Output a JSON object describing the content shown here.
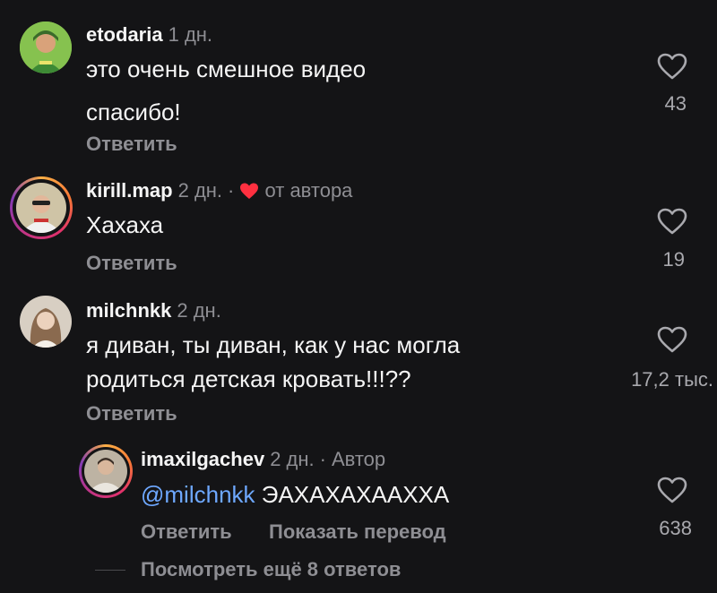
{
  "comments": [
    {
      "username": "etodaria",
      "time": "1 дн.",
      "lines": [
        "это очень смешное видео",
        "спасибо!"
      ],
      "reply_label": "Ответить",
      "likes": "43"
    },
    {
      "username": "kirill.map",
      "time": "2 дн.",
      "dot": "·",
      "author_badge": "от автора",
      "lines": [
        "Хахаха"
      ],
      "reply_label": "Ответить",
      "likes": "19"
    },
    {
      "username": "milchnkk",
      "time": "2 дн.",
      "lines": [
        "я диван, ты диван, как у нас могла",
        "родиться детская кровать!!!??"
      ],
      "reply_label": "Ответить",
      "likes": "17,2 тыс."
    }
  ],
  "reply": {
    "username": "imaxilgachev",
    "time": "2 дн.",
    "dot": "·",
    "author_label": "Автор",
    "mention": "@milchnkk",
    "text": "ЭАХАХАХААХХА",
    "reply_label": "Ответить",
    "translate_label": "Показать перевод",
    "likes": "638"
  },
  "view_more": "Посмотреть ещё 8 ответов",
  "colors": {
    "background": "#141416",
    "muted": "#8e8e93",
    "mention": "#6ea8ff",
    "heart": "#ff3040"
  },
  "icons": {
    "like": "heart-outline-icon",
    "author_like": "heart-filled-icon"
  }
}
